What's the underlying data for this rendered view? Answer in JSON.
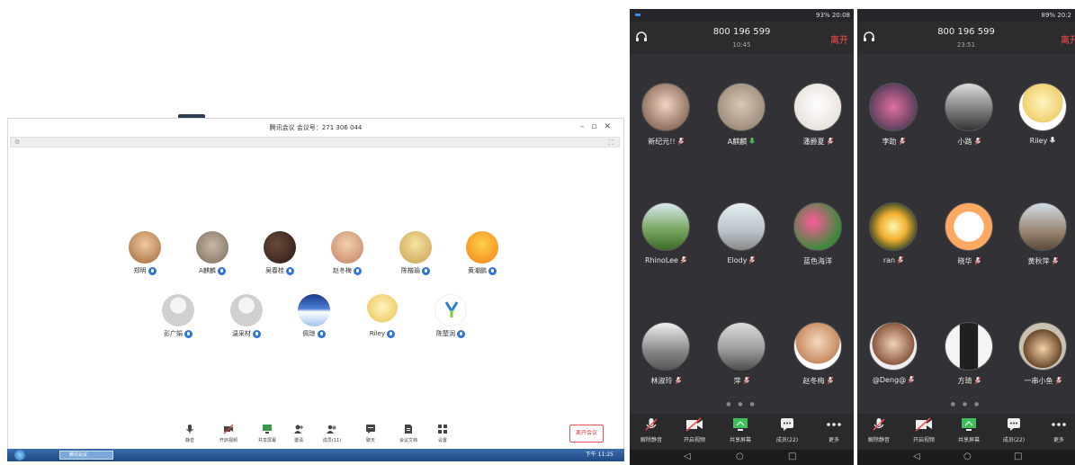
{
  "desktop": {
    "title": "腾讯会议  会议号：271 306 044",
    "toolbar": [
      {
        "label": "静音"
      },
      {
        "label": "开启视频"
      },
      {
        "label": "共享屏幕"
      },
      {
        "label": "邀请"
      },
      {
        "label": "成员(11)"
      },
      {
        "label": "聊天"
      },
      {
        "label": "会议文档"
      },
      {
        "label": "设置"
      }
    ],
    "leave_label": "离开会议",
    "participants": [
      {
        "name": "郑明"
      },
      {
        "name": "A麒麟"
      },
      {
        "name": "吴春桂"
      },
      {
        "name": "赵冬梅"
      },
      {
        "name": "陈楷瑜"
      },
      {
        "name": "黄潮鹏"
      },
      {
        "name": "彭广娟"
      },
      {
        "name": "温采材"
      },
      {
        "name": "佩琼"
      },
      {
        "name": "Riley"
      },
      {
        "name": "陈楚润"
      }
    ],
    "taskbar": {
      "app": "腾讯会议",
      "time": "下午 11:25"
    }
  },
  "phone1": {
    "status": "93%  20:08",
    "meeting_number": "800 196 599",
    "duration": "10:45",
    "leave_label": "离开",
    "participants": [
      {
        "name": "新纪元!!",
        "mic": "muted"
      },
      {
        "name": "A麒麟",
        "mic": "on"
      },
      {
        "name": "潘爵夏",
        "mic": "muted"
      },
      {
        "name": "RhinoLee",
        "mic": "muted"
      },
      {
        "name": "Elody",
        "mic": "muted"
      },
      {
        "name": "蓝色海洋",
        "mic": "none"
      },
      {
        "name": "林淑玲",
        "mic": "muted"
      },
      {
        "name": "萍",
        "mic": "muted"
      },
      {
        "name": "赵冬梅",
        "mic": "muted"
      }
    ],
    "toolbar": [
      {
        "label": "解除静音"
      },
      {
        "label": "开启视频"
      },
      {
        "label": "共享屏幕"
      },
      {
        "label": "成员(22)"
      },
      {
        "label": "更多"
      }
    ]
  },
  "phone2": {
    "status": "89%  20:2",
    "meeting_number": "800 196 599",
    "duration": "23:51",
    "leave_label": "离开",
    "participants": [
      {
        "name": "李助",
        "mic": "muted"
      },
      {
        "name": "小路",
        "mic": "muted"
      },
      {
        "name": "Riley",
        "mic": "on"
      },
      {
        "name": "ran",
        "mic": "muted"
      },
      {
        "name": "晓华",
        "mic": "muted"
      },
      {
        "name": "黄秋萍",
        "mic": "muted"
      },
      {
        "name": "@Deng@",
        "mic": "muted"
      },
      {
        "name": "方琦",
        "mic": "muted"
      },
      {
        "name": "一串小鱼",
        "mic": "muted"
      }
    ],
    "toolbar": [
      {
        "label": "解除静音"
      },
      {
        "label": "开启视频"
      },
      {
        "label": "共享屏幕"
      },
      {
        "label": "成员(22)"
      },
      {
        "label": "更多"
      }
    ]
  },
  "colors": {
    "accent": "#2f74d9",
    "leave_red": "#e23c3c",
    "phone_bg": "#2c2c2f"
  }
}
